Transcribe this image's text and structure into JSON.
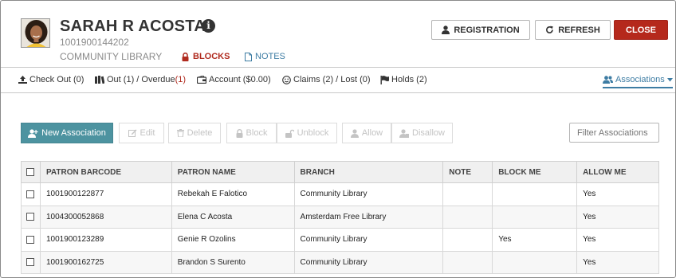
{
  "patron": {
    "name": "SARAH R ACOSTA",
    "barcode": "1001900144202",
    "library": "COMMUNITY LIBRARY",
    "blocks_label": "BLOCKS",
    "notes_label": "NOTES"
  },
  "header_buttons": {
    "registration": "REGISTRATION",
    "refresh": "REFRESH",
    "close": "CLOSE"
  },
  "tabs": {
    "checkout": "Check Out (0)",
    "out_prefix": "Out (1) / Overdue ",
    "out_overdue": "(1)",
    "account": "Account ($0.00)",
    "claims": "Claims (2) / Lost (0)",
    "holds": "Holds (2)",
    "associations": "Associations"
  },
  "toolbar": {
    "new_association": "New Association",
    "edit": "Edit",
    "delete": "Delete",
    "block": "Block",
    "unblock": "Unblock",
    "allow": "Allow",
    "disallow": "Disallow",
    "filter_placeholder": "Filter Associations"
  },
  "table": {
    "headers": [
      "PATRON BARCODE",
      "PATRON NAME",
      "BRANCH",
      "NOTE",
      "BLOCK ME",
      "ALLOW ME"
    ],
    "rows": [
      [
        "1001900122877",
        "Rebekah E Falotico",
        "Community Library",
        "",
        "",
        "Yes"
      ],
      [
        "1004300052868",
        "Elena C Acosta",
        "Amsterdam Free Library",
        "",
        "",
        "Yes"
      ],
      [
        "1001900123289",
        "Genie R Ozolins",
        "Community Library",
        "",
        "Yes",
        "Yes"
      ],
      [
        "1001900162725",
        "Brandon S Surento",
        "Community Library",
        "",
        "",
        "Yes"
      ]
    ]
  },
  "colors": {
    "close_button": "#b5291c",
    "new_button": "#4d93a0",
    "link": "#3d7ca3",
    "alert": "#b02a1e"
  },
  "icons": [
    "info-icon",
    "lock-icon",
    "document-icon",
    "person-icon",
    "refresh-icon",
    "upload-icon",
    "books-icon",
    "wallet-icon",
    "smile-icon",
    "flag-icon",
    "users-icon",
    "caret-down-icon",
    "add-user-icon",
    "edit-icon",
    "trash-icon",
    "unlock-icon",
    "allow-icon",
    "disallow-icon"
  ]
}
